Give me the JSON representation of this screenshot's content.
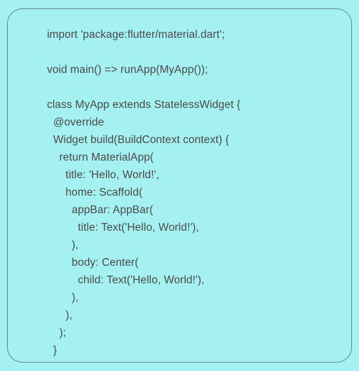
{
  "code": {
    "lines": [
      "import 'package:flutter/material.dart';",
      "",
      "void main() => runApp(MyApp());",
      "",
      "class MyApp extends StatelessWidget {",
      "  @override",
      "  Widget build(BuildContext context) {",
      "    return MaterialApp(",
      "      title: 'Hello, World!',",
      "      home: Scaffold(",
      "        appBar: AppBar(",
      "          title: Text('Hello, World!'),",
      "        ),",
      "        body: Center(",
      "          child: Text('Hello, World!'),",
      "        ),",
      "      ),",
      "    );",
      "  }",
      "}"
    ]
  }
}
